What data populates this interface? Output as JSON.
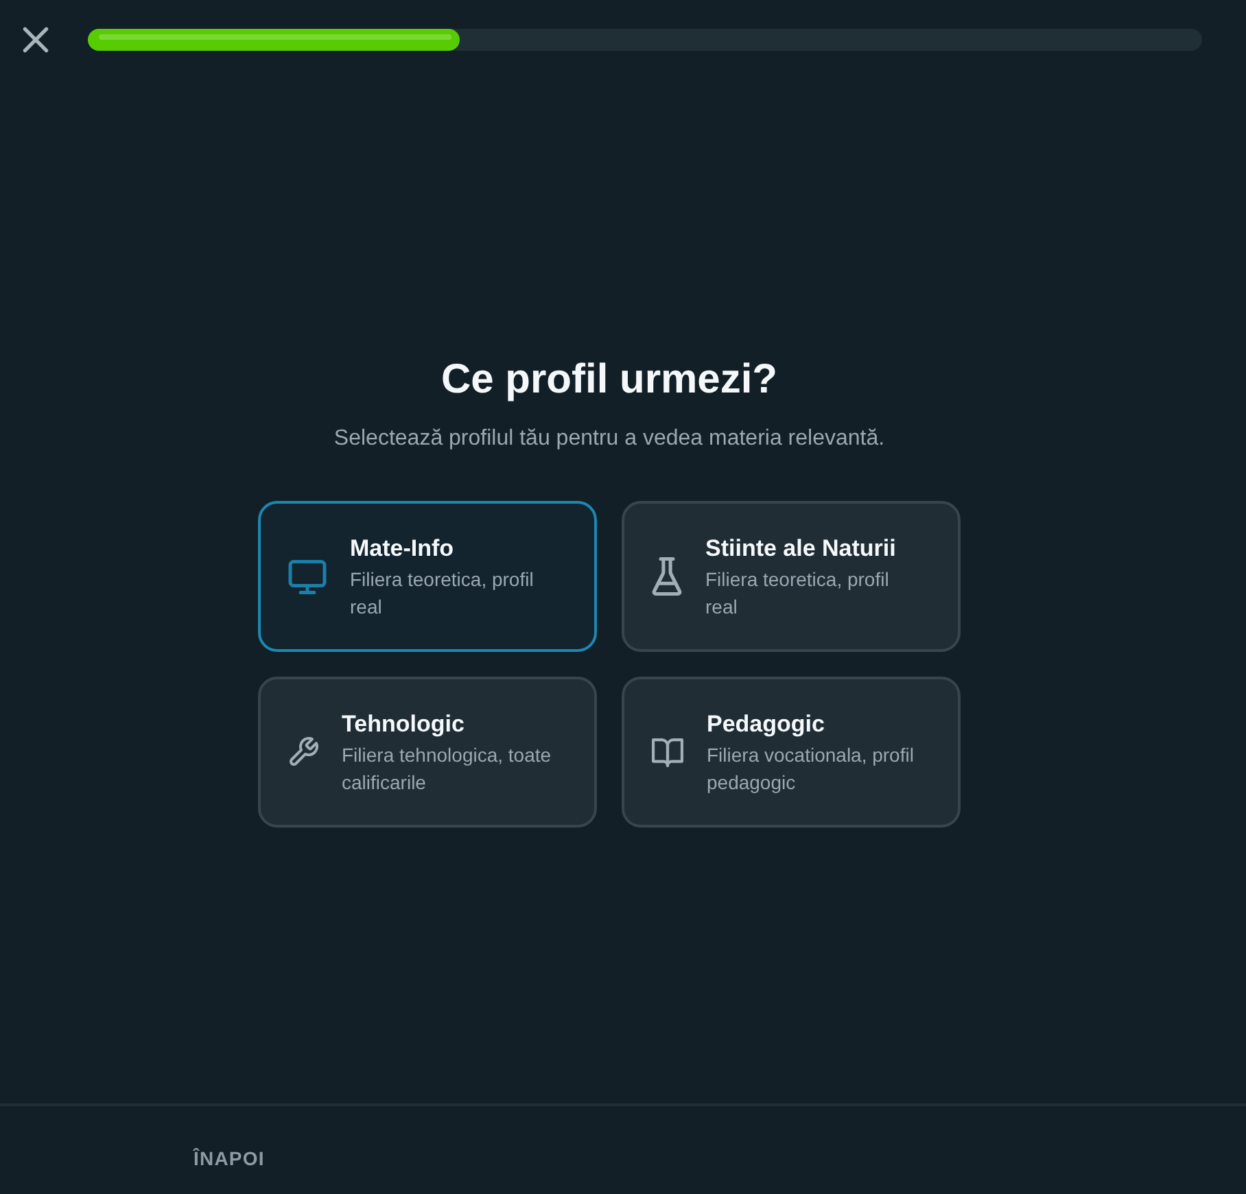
{
  "progress": {
    "level": 0.334
  },
  "heading": {
    "title": "Ce profil urmezi?",
    "subtitle": "Selectează profilul tău pentru a vedea materia relevantă."
  },
  "profiles": [
    {
      "title": "Mate-Info",
      "description": "Filiera teoretica, profil real",
      "selected": true
    },
    {
      "title": "Stiinte ale Naturii",
      "description": "Filiera teoretica, profil real",
      "selected": false
    },
    {
      "title": "Tehnologic",
      "description": "Filiera tehnologica, toate calificarile",
      "selected": false
    },
    {
      "title": "Pedagogic",
      "description": "Filiera vocationala, profil pedagogic",
      "selected": false
    }
  ],
  "footer": {
    "back_button": "ÎNAPOI"
  }
}
